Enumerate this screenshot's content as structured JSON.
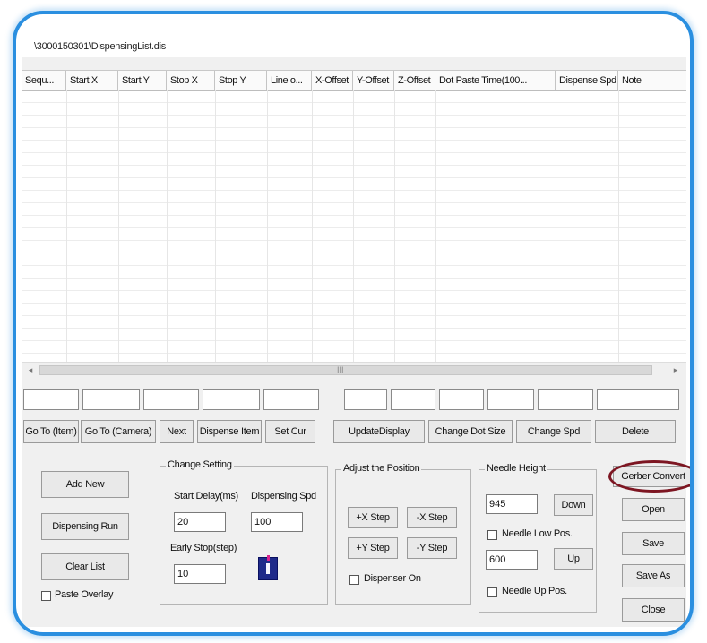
{
  "window": {
    "title": "\\3000150301\\DispensingList.dis"
  },
  "list": {
    "columns": [
      "Sequ...",
      "Start X",
      "Start Y",
      "Stop X",
      "Stop Y",
      "Line o...",
      "X-Offset",
      "Y-Offset",
      "Z-Offset",
      "Dot Paste Time(100...",
      "Dispense Spd",
      "Note"
    ]
  },
  "scrollbar": {
    "left_arrow": "◂",
    "right_arrow": "▸",
    "grip": "III"
  },
  "action_buttons": {
    "goto_item": "Go To (Item)",
    "goto_camera": "Go To (Camera)",
    "next": "Next",
    "dispense_item": "Dispense Item",
    "set_cur": "Set Cur",
    "update_display": "UpdateDisplay",
    "change_dot_size": "Change Dot Size",
    "change_spd": "Change Spd",
    "delete": "Delete"
  },
  "left_panel": {
    "add_new": "Add New",
    "dispensing_run": "Dispensing Run",
    "clear_list": "Clear List",
    "paste_overlay": "Paste Overlay"
  },
  "change_setting": {
    "title": "Change Setting",
    "start_delay_label": "Start Delay(ms)",
    "start_delay_value": "20",
    "dispensing_spd_label": "Dispensing Spd",
    "dispensing_spd_value": "100",
    "early_stop_label": "Early Stop(step)",
    "early_stop_value": "10"
  },
  "adjust_position": {
    "title": "Adjust the Position",
    "plus_x": "+X Step",
    "minus_x": "-X Step",
    "plus_y": "+Y Step",
    "minus_y": "-Y Step",
    "dispenser_on": "Dispenser On"
  },
  "needle_height": {
    "title": "Needle Height",
    "down_value": "945",
    "down_button": "Down",
    "low_pos": "Needle Low Pos.",
    "up_value": "600",
    "up_button": "Up",
    "up_pos": "Needle Up Pos."
  },
  "right_buttons": {
    "gerber_convert": "Gerber Convert",
    "open": "Open",
    "save": "Save",
    "save_as": "Save As",
    "close": "Close"
  },
  "colors": {
    "frame_glow": "#2a8fe0",
    "highlight_ring": "#7d1622",
    "icon_chip": "#1f2a8a"
  }
}
